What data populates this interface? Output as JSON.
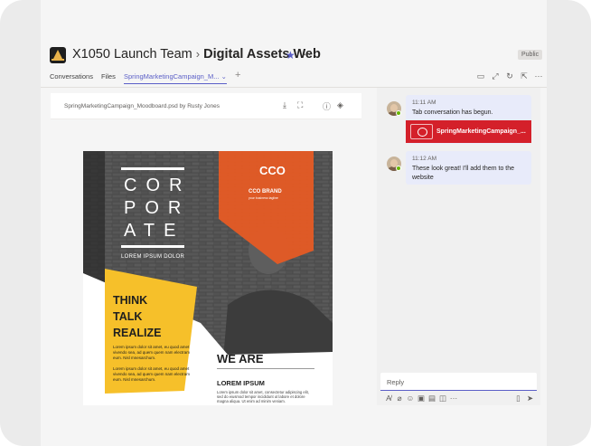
{
  "header": {
    "team": "X1050 Launch Team",
    "channel": "Digital Assets Web",
    "visibility": "Public"
  },
  "tabs": [
    {
      "label": "Conversations"
    },
    {
      "label": "Files"
    },
    {
      "label": "SpringMarketingCampaign_M..."
    }
  ],
  "viewer": {
    "file_name": "SpringMarketingCampaign_Moodboard.psd by Rusty Jones"
  },
  "poster": {
    "corporate_lines": [
      "COR",
      "POR",
      "ATE"
    ],
    "tagline": "LOREM IPSUM DOLOR",
    "brand_mark": "CCO",
    "brand_name": "CCO BRAND",
    "brand_sub": "your business tagline",
    "think_lines": [
      "THINK",
      "TALK",
      "REALIZE"
    ],
    "yellow_body_1": "Lorem ipsum dolor sit amet, eu quod amet vivendo sea, ad quem quem nam electram eum. Nisl mnesarchum.",
    "yellow_body_2": "Lorem ipsum dolor sit amet, eu quod amet vivendo sea, ad quem quem nam electram eum. Nisl mnesarchum.",
    "we_are": "WE ARE",
    "lorem_ipsum": "LOREM IPSUM",
    "lorem_body": "Lorem ipsum dolor sit amet, consectetur adipiscing elit, sed do eiusmod tempor incididunt ut labore et dolore magna aliqua. Ut enim ad minim veniam."
  },
  "conversation": {
    "messages": [
      {
        "time": "11:11 AM",
        "text": "Tab conversation has begun.",
        "attachment": "SpringMarketingCampaign_..."
      },
      {
        "time": "11:12 AM",
        "text": "These look great! I'll add them to the website"
      }
    ],
    "reply_placeholder": "Reply"
  },
  "colors": {
    "accent": "#5b5fc7",
    "attachment_red": "#d4202a",
    "poster_orange": "#e85a24",
    "poster_yellow": "#f6c02a"
  },
  "icons": {
    "tab_bar": [
      "chat-icon",
      "expand-icon",
      "refresh-icon",
      "popout-icon",
      "more-icon"
    ],
    "viewer": [
      "download-icon",
      "fit-icon",
      "info-icon",
      "layers-icon"
    ],
    "compose": [
      "format-icon",
      "attach-icon",
      "emoji-icon",
      "gif-icon",
      "sticker-icon",
      "meet-icon",
      "more-icon",
      "delete-icon",
      "send-icon"
    ]
  }
}
